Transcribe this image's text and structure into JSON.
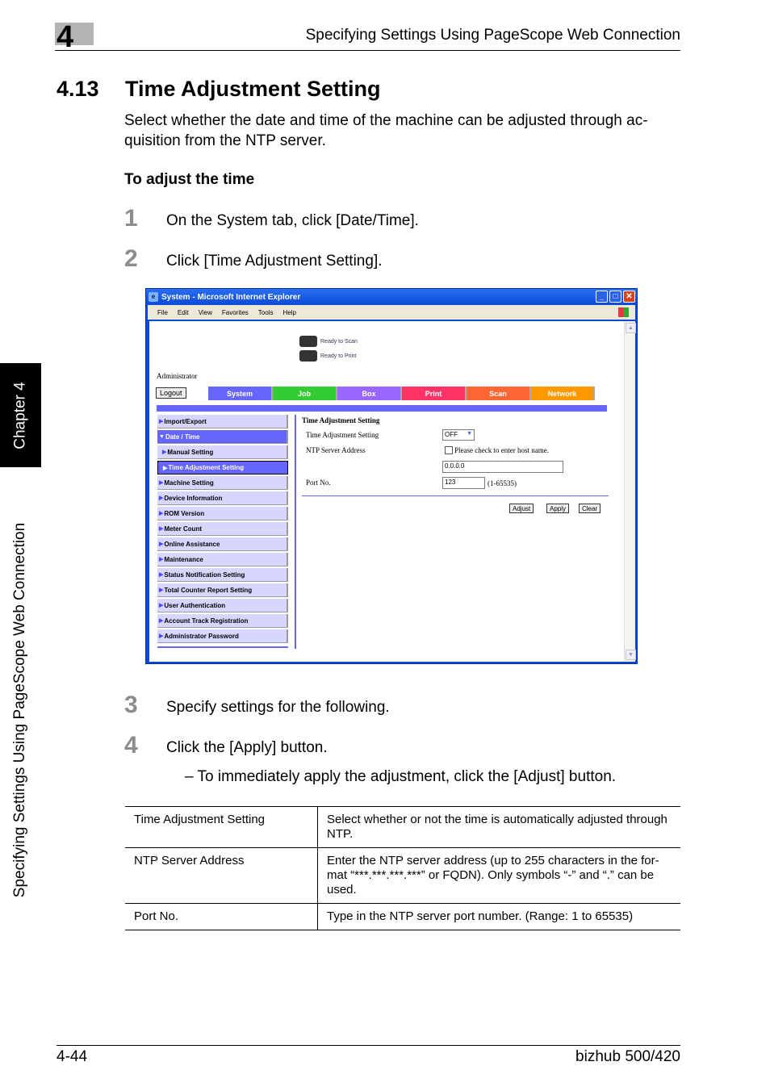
{
  "header": {
    "chapter_number": "4",
    "running_title": "Specifying Settings Using PageScope Web Connection"
  },
  "section": {
    "number": "4.13",
    "title": "Time Adjustment Setting"
  },
  "intro": "Select whether the date and time of the machine can be adjusted through ac-quisition from the NTP server.",
  "subheading": "To adjust the time",
  "steps": [
    {
      "num": "1",
      "text": "On the System tab, click [Date/Time]."
    },
    {
      "num": "2",
      "text": "Click [Time Adjustment Setting]."
    },
    {
      "num": "3",
      "text": "Specify settings for the following."
    },
    {
      "num": "4",
      "text": "Click the [Apply] button."
    }
  ],
  "step4_note": "–   To immediately apply the adjustment, click the [Adjust] button.",
  "side_tab": {
    "chapter": "Chapter 4",
    "title": "Specifying Settings Using PageScope Web Connection"
  },
  "browser": {
    "title": "System - Microsoft Internet Explorer",
    "menu": [
      "File",
      "Edit",
      "View",
      "Favorites",
      "Tools",
      "Help"
    ],
    "status": [
      {
        "text": "Ready to Scan"
      },
      {
        "text": "Ready to Print"
      }
    ],
    "user_label": "Administrator",
    "logout_label": "Logout",
    "tabs": [
      {
        "label": "System",
        "color": "#6666ff"
      },
      {
        "label": "Job",
        "color": "#33cc33"
      },
      {
        "label": "Box",
        "color": "#9966ff"
      },
      {
        "label": "Print",
        "color": "#ff3366"
      },
      {
        "label": "Scan",
        "color": "#ff6633"
      },
      {
        "label": "Network",
        "color": "#ff9900"
      }
    ],
    "sidebar": [
      {
        "label": "Import/Export",
        "state": "normal"
      },
      {
        "label": "Date / Time",
        "state": "expanded"
      },
      {
        "label": "Manual Setting",
        "state": "sub"
      },
      {
        "label": "Time Adjustment Setting",
        "state": "current"
      },
      {
        "label": "Machine Setting",
        "state": "normal"
      },
      {
        "label": "Device Information",
        "state": "normal"
      },
      {
        "label": "ROM Version",
        "state": "normal"
      },
      {
        "label": "Meter Count",
        "state": "normal"
      },
      {
        "label": "Online Assistance",
        "state": "normal"
      },
      {
        "label": "Maintenance",
        "state": "normal"
      },
      {
        "label": "Status Notification Setting",
        "state": "normal"
      },
      {
        "label": "Total Counter Report Setting",
        "state": "normal"
      },
      {
        "label": "User Authentication",
        "state": "normal"
      },
      {
        "label": "Account Track Registration",
        "state": "normal"
      },
      {
        "label": "Administrator Password",
        "state": "normal"
      }
    ],
    "form": {
      "heading": "Time Adjustment Setting",
      "time_adj_label": "Time Adjustment Setting",
      "time_adj_value": "OFF",
      "ntp_label": "NTP Server Address",
      "host_checkbox_label": "Please check to enter host name.",
      "ntp_value": "0.0.0.0",
      "port_label": "Port No.",
      "port_value": "123",
      "port_range": "(1-65535)",
      "buttons": {
        "adjust": "Adjust",
        "apply": "Apply",
        "clear": "Clear"
      }
    }
  },
  "table": [
    {
      "item": "Time Adjustment Setting",
      "desc": "Select whether or not the time is automatically adjusted through NTP."
    },
    {
      "item": "NTP Server Address",
      "desc": "Enter the NTP server address (up to 255 characters in the for-mat “***.***.***.***” or FQDN). Only symbols “-” and “.” can be used."
    },
    {
      "item": "Port No.",
      "desc": "Type in the NTP server port number. (Range: 1 to 65535)"
    }
  ],
  "footer": {
    "page": "4-44",
    "product": "bizhub 500/420"
  }
}
